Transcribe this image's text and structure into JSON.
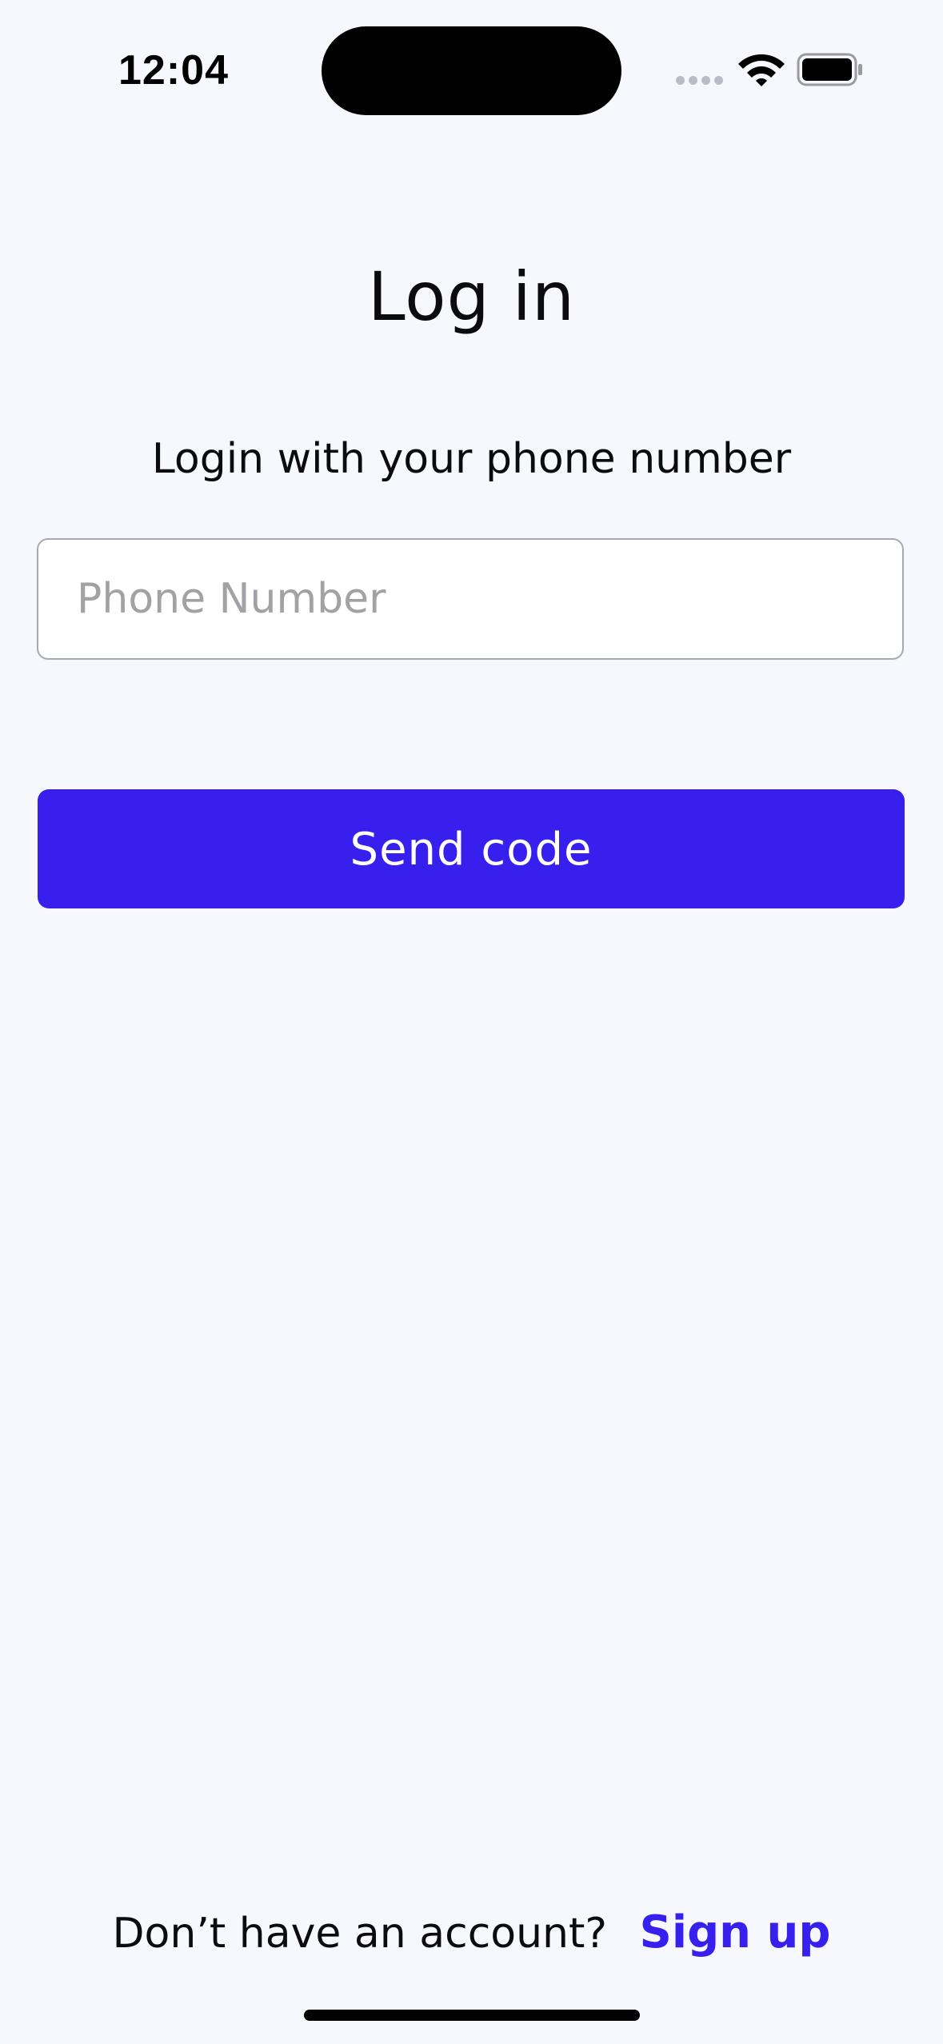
{
  "status_bar": {
    "time": "12:04",
    "icons": [
      "cellular-signal-icon",
      "wifi-icon",
      "battery-icon"
    ]
  },
  "login": {
    "title": "Log in",
    "subtitle": "Login with your phone number",
    "phone_placeholder": "Phone Number",
    "phone_value": "",
    "send_button_label": "Send code"
  },
  "footer": {
    "prompt": "Don’t have an account?",
    "signup_label": "Sign up"
  },
  "colors": {
    "accent": "#3720ee",
    "background": "#f7f8fd"
  }
}
